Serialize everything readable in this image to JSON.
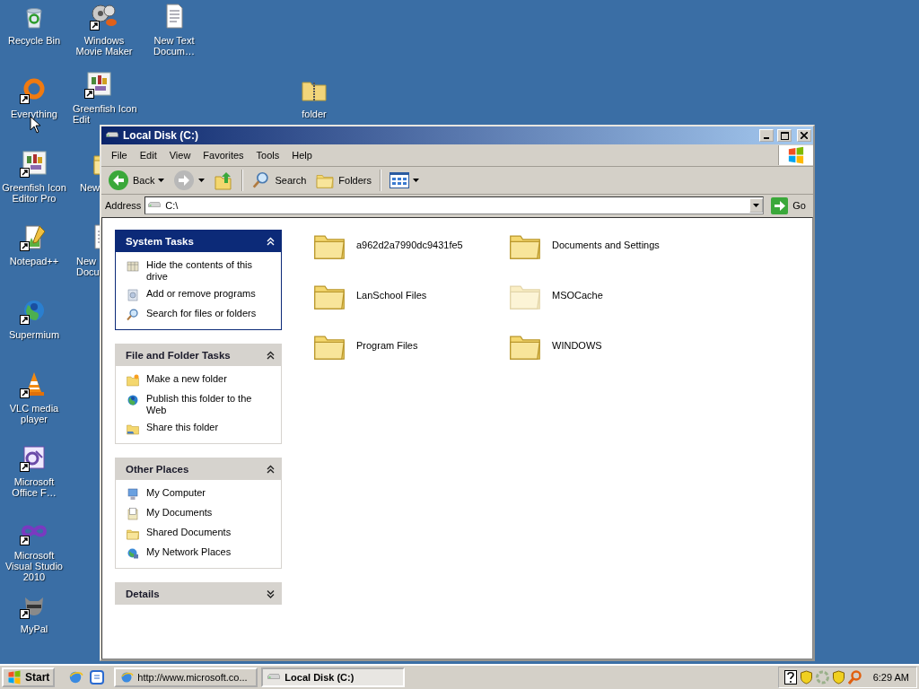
{
  "desktop_icons": [
    {
      "label": "Recycle Bin",
      "kind": "recycle",
      "shortcut": false
    },
    {
      "label": "Windows Movie Maker",
      "kind": "film",
      "shortcut": true
    },
    {
      "label": "New Text Docum…",
      "kind": "doc",
      "shortcut": false
    },
    {
      "label": "Everything",
      "kind": "ring",
      "shortcut": true
    },
    {
      "label": "Greenfish Icon Edit",
      "kind": "tile",
      "shortcut": true
    },
    {
      "label": "folder",
      "kind": "zipfolder",
      "shortcut": false
    },
    {
      "label": "Greenfish Icon Editor Pro",
      "kind": "tile",
      "shortcut": true
    },
    {
      "label": "New",
      "kind": "folder",
      "shortcut": false
    },
    {
      "label": "Notepad++",
      "kind": "notepad",
      "shortcut": true
    },
    {
      "label": "New Docu",
      "kind": "doc",
      "shortcut": false
    },
    {
      "label": "Supermium",
      "kind": "globe",
      "shortcut": true
    },
    {
      "label": "VLC media player",
      "kind": "cone",
      "shortcut": true
    },
    {
      "label": "Microsoft Office F…",
      "kind": "office",
      "shortcut": true
    },
    {
      "label": "Microsoft Visual Studio 2010",
      "kind": "infinity",
      "shortcut": true
    },
    {
      "label": "MyPal",
      "kind": "animal",
      "shortcut": true
    }
  ],
  "window": {
    "title": "Local Disk (C:)",
    "menu": [
      "File",
      "Edit",
      "View",
      "Favorites",
      "Tools",
      "Help"
    ],
    "toolbar": {
      "back": "Back",
      "forward": {
        "disabled": true
      },
      "search": "Search",
      "folders": "Folders"
    },
    "address": {
      "label": "Address",
      "value": "C:\\",
      "go": "Go"
    },
    "task_panels": [
      {
        "title": "System Tasks",
        "kind": "primary",
        "expanded": true,
        "items": [
          {
            "label": "Hide the contents of this drive",
            "kind": "hide"
          },
          {
            "label": "Add or remove programs",
            "kind": "programs"
          },
          {
            "label": "Search for files or folders",
            "kind": "search"
          }
        ]
      },
      {
        "title": "File and Folder Tasks",
        "kind": "normal",
        "expanded": true,
        "items": [
          {
            "label": "Make a new folder",
            "kind": "newfolder"
          },
          {
            "label": "Publish this folder to the Web",
            "kind": "globe"
          },
          {
            "label": "Share this folder",
            "kind": "share"
          }
        ]
      },
      {
        "title": "Other Places",
        "kind": "normal",
        "expanded": true,
        "items": [
          {
            "label": "My Computer",
            "kind": "computer"
          },
          {
            "label": "My Documents",
            "kind": "documents"
          },
          {
            "label": "Shared Documents",
            "kind": "folder"
          },
          {
            "label": "My Network Places",
            "kind": "network"
          }
        ]
      },
      {
        "title": "Details",
        "kind": "normal",
        "expanded": false
      }
    ],
    "folders": [
      {
        "name": "a962d2a7990dc9431fe5",
        "hidden": false
      },
      {
        "name": "Documents and Settings",
        "hidden": false
      },
      {
        "name": "LanSchool Files",
        "hidden": false
      },
      {
        "name": "MSOCache",
        "hidden": true
      },
      {
        "name": "Program Files",
        "hidden": false
      },
      {
        "name": "WINDOWS",
        "hidden": false
      }
    ]
  },
  "taskbar": {
    "start": "Start",
    "tasks": [
      {
        "label": "http://www.microsoft.co...",
        "kind": "browser",
        "selected": false
      },
      {
        "label": "Local Disk (C:)",
        "kind": "drive",
        "selected": true
      }
    ],
    "clock": "6:29 AM"
  }
}
